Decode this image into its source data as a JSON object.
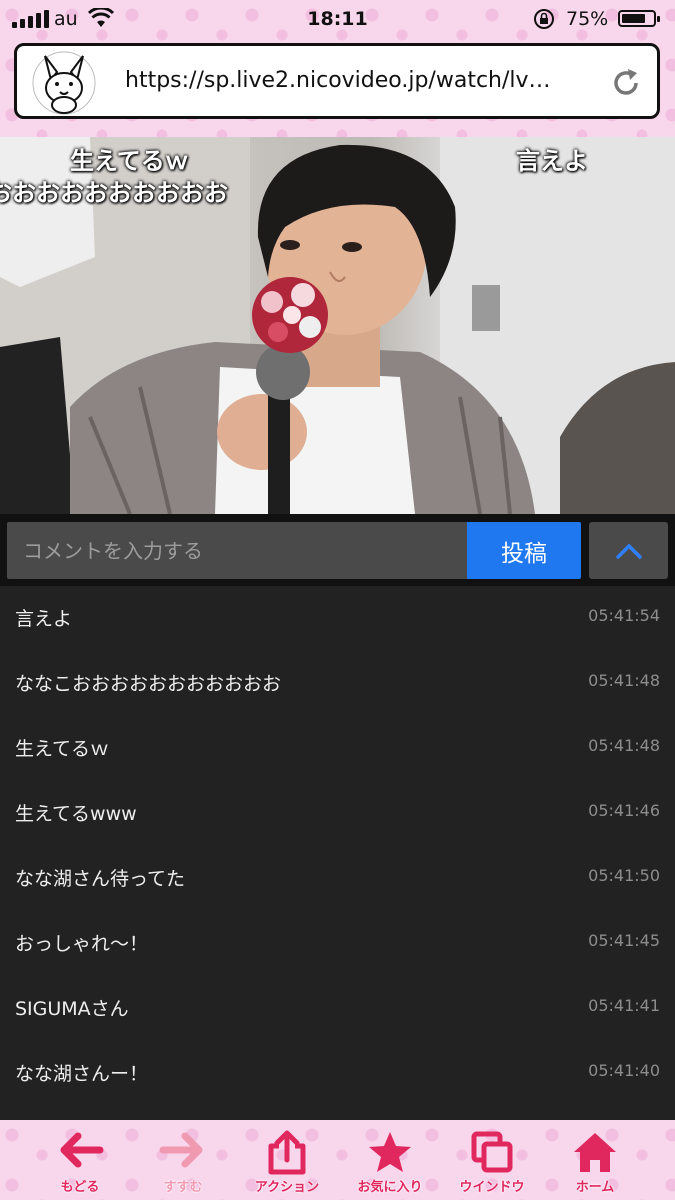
{
  "status": {
    "carrier": "au",
    "time": "18:11",
    "battery": "75%",
    "battery_level": 0.75
  },
  "browser": {
    "url": "https://sp.live2.nicovideo.jp/watch/lv…"
  },
  "video": {
    "danmaku": [
      {
        "text": "生えてるｗ"
      },
      {
        "text": "おおおおおおおおおお"
      },
      {
        "text": "言えよ"
      }
    ]
  },
  "comment_input": {
    "placeholder": "コメントを入力する",
    "post_label": "投稿"
  },
  "comments": [
    {
      "text": "言えよ",
      "time": "05:41:54"
    },
    {
      "text": "ななこおおおおおおおおおおお",
      "time": "05:41:48"
    },
    {
      "text": "生えてるｗ",
      "time": "05:41:48"
    },
    {
      "text": "生えてるwww",
      "time": "05:41:46"
    },
    {
      "text": "なな湖さん待ってた",
      "time": "05:41:50"
    },
    {
      "text": "おっしゃれ〜！",
      "time": "05:41:45"
    },
    {
      "text": "SIGUMAさん",
      "time": "05:41:41"
    },
    {
      "text": "なな湖さんー！",
      "time": "05:41:40"
    }
  ],
  "toolbar": {
    "back": "もどる",
    "forward": "すすむ",
    "action": "アクション",
    "favorites": "お気に入り",
    "window": "ウインドウ",
    "home": "ホーム"
  },
  "colors": {
    "accent": "#e0285f",
    "post_button": "#1f78f0",
    "pink_bg": "#f8d6ec"
  }
}
